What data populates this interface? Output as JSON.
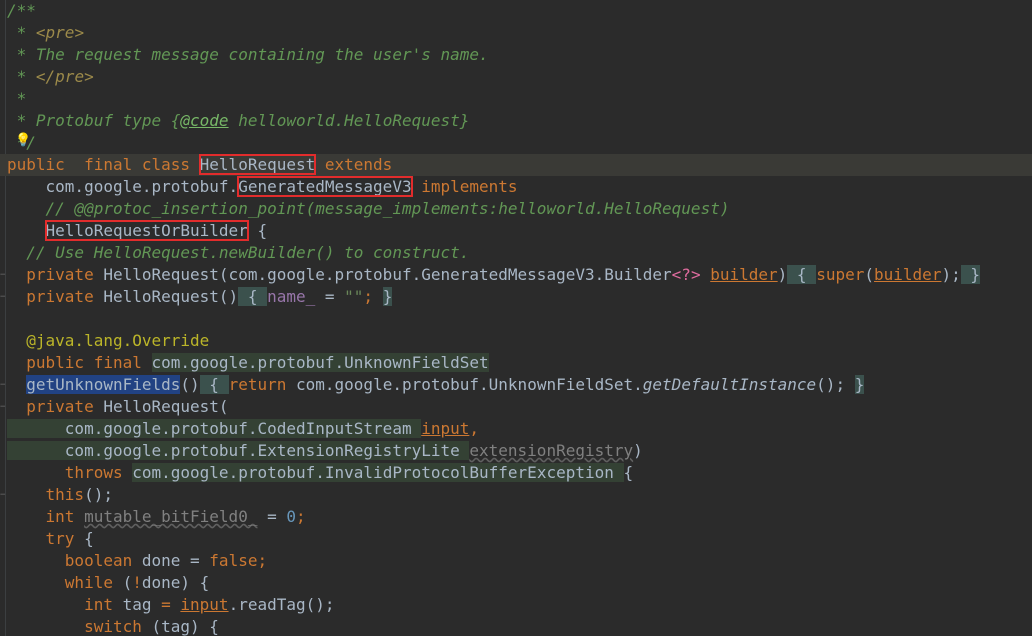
{
  "editor": {
    "language": "java",
    "theme": "Darcula",
    "highlight_box_color": "#e22c2c",
    "lines": [
      {
        "t": [
          {
            "s": "/**",
            "c": "doc"
          }
        ]
      },
      {
        "t": [
          {
            "s": " * ",
            "c": "doc"
          },
          {
            "s": "<pre>",
            "c": "htag"
          }
        ]
      },
      {
        "t": [
          {
            "s": " * The request message containing the user's name.",
            "c": "doc"
          }
        ]
      },
      {
        "t": [
          {
            "s": " * ",
            "c": "doc"
          },
          {
            "s": "</pre>",
            "c": "htag"
          }
        ]
      },
      {
        "t": [
          {
            "s": " *",
            "c": "doc"
          }
        ]
      },
      {
        "t": [
          {
            "s": " * Protobuf type {",
            "c": "doc"
          },
          {
            "s": "@code",
            "c": "doctag"
          },
          {
            "s": " helloworld.HelloRequest}",
            "c": "doc"
          }
        ]
      },
      {
        "t": [
          {
            "s": " */",
            "c": "doc"
          }
        ],
        "icon": "lightbulb-icon"
      },
      {
        "t": [
          {
            "s": "public  ",
            "c": "kw"
          },
          {
            "s": "final ",
            "c": "kw"
          },
          {
            "s": "class ",
            "c": "kw"
          },
          {
            "s": "HelloRequest",
            "c": "cls boxed"
          },
          {
            "s": " extends",
            "c": "kw"
          }
        ],
        "current": true
      },
      {
        "t": [
          {
            "s": "    com.google.protobuf.",
            "c": "pkg"
          },
          {
            "s": "GeneratedMessageV3",
            "c": "cls boxed"
          },
          {
            "s": " implements",
            "c": "kw"
          }
        ]
      },
      {
        "t": [
          {
            "s": "    // @@protoc_insertion_point(message_implements:helloworld.HelloRequest)",
            "c": "cmt"
          }
        ]
      },
      {
        "t": [
          {
            "s": "    ",
            "c": "cls"
          },
          {
            "s": "HelloRequestOrBuilder",
            "c": "cls boxed"
          },
          {
            "s": " {",
            "c": "cls"
          }
        ]
      },
      {
        "t": [
          {
            "s": "  // Use HelloRequest.newBuilder() to construct.",
            "c": "cmt"
          }
        ]
      },
      {
        "t": [
          {
            "s": "  private ",
            "c": "kw"
          },
          {
            "s": "HelloRequest(com.google.protobuf.GeneratedMessageV3.Builder",
            "c": "cls"
          },
          {
            "s": "<?>",
            "c": "pink"
          },
          {
            "s": " ",
            "c": "cls"
          },
          {
            "s": "builder",
            "c": "param"
          },
          {
            "s": ")",
            "c": "cls"
          },
          {
            "s": " { ",
            "c": "fold-bg"
          },
          {
            "s": "super",
            "c": "kw"
          },
          {
            "s": "(",
            "c": "cls"
          },
          {
            "s": "builder",
            "c": "param"
          },
          {
            "s": ");",
            "c": "cls"
          },
          {
            "s": " }",
            "c": "fold-bg"
          }
        ],
        "fold": true
      },
      {
        "t": [
          {
            "s": "  private ",
            "c": "kw"
          },
          {
            "s": "HelloRequest()",
            "c": "cls"
          },
          {
            "s": " { ",
            "c": "fold-bg"
          },
          {
            "s": "name_ ",
            "c": "fld"
          },
          {
            "s": "= ",
            "c": "cls"
          },
          {
            "s": "\"\"",
            "c": "str"
          },
          {
            "s": "; ",
            "c": "kw"
          },
          {
            "s": "}",
            "c": "fold-bg"
          }
        ],
        "fold": true
      },
      {
        "t": [
          {
            "s": "",
            "c": "cls"
          }
        ]
      },
      {
        "t": [
          {
            "s": "  @java.lang.Override",
            "c": "ann"
          }
        ]
      },
      {
        "t": [
          {
            "s": "  public ",
            "c": "kw"
          },
          {
            "s": "final ",
            "c": "kw"
          },
          {
            "s": "com.google.protobuf.UnknownFieldSet",
            "c": "cls hl"
          }
        ]
      },
      {
        "t": [
          {
            "s": "  ",
            "c": "cls"
          },
          {
            "s": "getUnknownFields",
            "c": "cls sel"
          },
          {
            "s": "()",
            "c": "cls"
          },
          {
            "s": " { ",
            "c": "fold-bg"
          },
          {
            "s": "return ",
            "c": "kw"
          },
          {
            "s": "com.google.protobuf.UnknownFieldSet.",
            "c": "cls"
          },
          {
            "s": "getDefaultInstance",
            "c": "cls ital"
          },
          {
            "s": "(); ",
            "c": "cls"
          },
          {
            "s": "}",
            "c": "fold-bg"
          }
        ],
        "fold": true
      },
      {
        "t": [
          {
            "s": "  private ",
            "c": "kw"
          },
          {
            "s": "HelloRequest(",
            "c": "cls"
          }
        ],
        "fold": true
      },
      {
        "t": [
          {
            "s": "      com.google.protobuf.CodedInputStream ",
            "c": "cls hl"
          },
          {
            "s": "input",
            "c": "param"
          },
          {
            "s": ",",
            "c": "kw"
          }
        ]
      },
      {
        "t": [
          {
            "s": "      com.google.protobuf.ExtensionRegistryLite ",
            "c": "cls hl"
          },
          {
            "s": "extensionRegistry",
            "c": "wavy"
          },
          {
            "s": ")",
            "c": "cls"
          }
        ]
      },
      {
        "t": [
          {
            "s": "      throws ",
            "c": "kw"
          },
          {
            "s": "com.google.protobuf.InvalidProtocolBufferException ",
            "c": "cls hl"
          },
          {
            "s": "{",
            "c": "cls"
          }
        ]
      },
      {
        "t": [
          {
            "s": "    this",
            "c": "kw"
          },
          {
            "s": "();",
            "c": "cls"
          }
        ],
        "fold": true
      },
      {
        "t": [
          {
            "s": "    int ",
            "c": "kw"
          },
          {
            "s": "mutable_bitField0_",
            "c": "wavy"
          },
          {
            "s": " = ",
            "c": "cls"
          },
          {
            "s": "0",
            "c": "num"
          },
          {
            "s": ";",
            "c": "kw"
          }
        ]
      },
      {
        "t": [
          {
            "s": "    try ",
            "c": "kw"
          },
          {
            "s": "{",
            "c": "cls"
          }
        ]
      },
      {
        "t": [
          {
            "s": "      boolean ",
            "c": "kw"
          },
          {
            "s": "done ",
            "c": "cls"
          },
          {
            "s": "= ",
            "c": "cls"
          },
          {
            "s": "false",
            "c": "kw"
          },
          {
            "s": ";",
            "c": "kw"
          }
        ]
      },
      {
        "t": [
          {
            "s": "      while ",
            "c": "kw"
          },
          {
            "s": "(",
            "c": "cls"
          },
          {
            "s": "!",
            "c": "kw"
          },
          {
            "s": "done) {",
            "c": "cls"
          }
        ]
      },
      {
        "t": [
          {
            "s": "        int ",
            "c": "kw"
          },
          {
            "s": "tag ",
            "c": "cls"
          },
          {
            "s": "= ",
            "c": "kw"
          },
          {
            "s": "input",
            "c": "param"
          },
          {
            "s": ".readTag();",
            "c": "cls"
          }
        ]
      },
      {
        "t": [
          {
            "s": "        switch ",
            "c": "kw"
          },
          {
            "s": "(tag) {",
            "c": "cls"
          }
        ]
      }
    ]
  }
}
